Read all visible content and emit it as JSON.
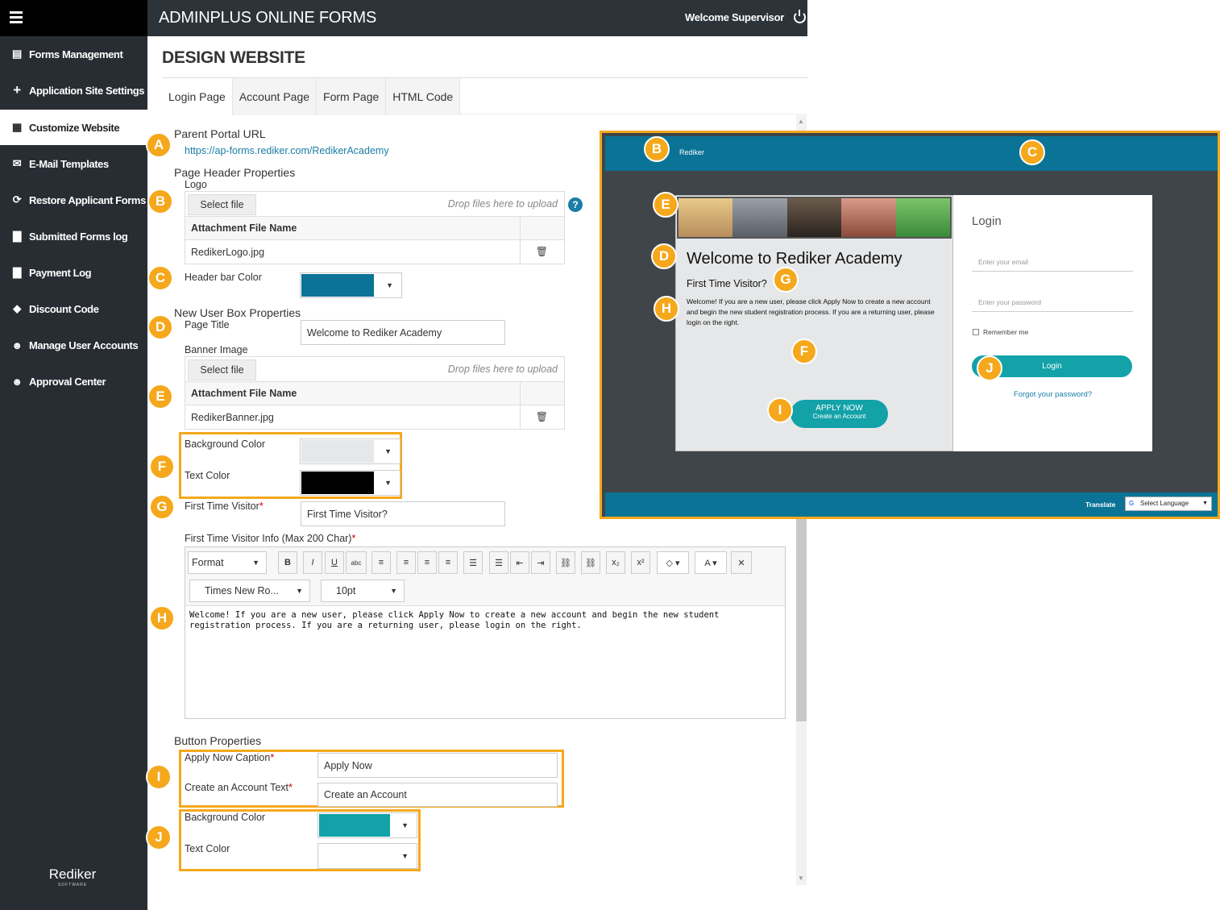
{
  "app": {
    "title": "ADMINPLUS ONLINE FORMS",
    "welcome": "Welcome Supervisor"
  },
  "sidebar": {
    "items": [
      {
        "label": "Forms Management",
        "icon": "list-icon"
      },
      {
        "label": "Application Site Settings",
        "icon": "plus-icon"
      },
      {
        "label": "Customize Website",
        "icon": "grid-icon",
        "active": true
      },
      {
        "label": "E-Mail Templates",
        "icon": "envelope-icon"
      },
      {
        "label": "Restore Applicant Forms",
        "icon": "refresh-icon"
      },
      {
        "label": "Submitted Forms log",
        "icon": "document-icon"
      },
      {
        "label": "Payment Log",
        "icon": "document-icon"
      },
      {
        "label": "Discount Code",
        "icon": "tag-icon"
      },
      {
        "label": "Manage User Accounts",
        "icon": "users-icon"
      },
      {
        "label": "Approval Center",
        "icon": "users-icon"
      }
    ],
    "logo": "Rediker",
    "logo_sub": "SOFTWARE"
  },
  "page": {
    "title": "DESIGN WEBSITE"
  },
  "tabs": [
    "Login Page",
    "Account Page",
    "Form Page",
    "HTML Code"
  ],
  "form": {
    "parent_portal_label": "Parent Portal URL",
    "parent_portal_url": "https://ap-forms.rediker.com/RedikerAcademy",
    "page_header_props": "Page Header Properties",
    "logo_label": "Logo",
    "select_file": "Select file",
    "drop_files": "Drop files here to upload",
    "attachment_header": "Attachment File Name",
    "logo_file": "RedikerLogo.jpg",
    "header_bar_color_label": "Header bar Color",
    "header_bar_color": "#0a7396",
    "new_user_box_props": "New User Box Properties",
    "page_title_label": "Page Title",
    "page_title_value": "Welcome to Rediker Academy",
    "banner_image_label": "Banner Image",
    "banner_file": "RedikerBanner.jpg",
    "bg_color_label": "Background Color",
    "bg_color": "#e6e7e8",
    "text_color_label": "Text Color",
    "text_color": "#000000",
    "first_time_label": "First Time Visitor",
    "first_time_value": "First Time Visitor?",
    "first_time_info_label": "First Time Visitor Info (Max 200 Char)",
    "editor": {
      "format": "Format",
      "font": "Times New Ro...",
      "size": "10pt",
      "content": "Welcome!  If you are a new user, please click Apply Now to create a new account and begin the new student registration process.   If you are a returning user, please login on the right."
    },
    "button_props": "Button Properties",
    "apply_caption_label": "Apply Now Caption",
    "apply_caption_value": "Apply Now",
    "create_account_label": "Create an Account Text",
    "create_account_value": "Create an Account",
    "btn_bg_color_label": "Background Color",
    "btn_bg_color": "#12a2a8",
    "btn_text_color_label": "Text Color"
  },
  "preview": {
    "logo": "Rediker",
    "welcome_title": "Welcome to Rediker Academy",
    "first_time": "First Time Visitor?",
    "info": "Welcome!  If you are a new user, please click Apply Now to create a new account and begin the new student registration process.   If you are a returning user, please login on the right.",
    "apply_now": "APPLY NOW",
    "create_account": "Create an Account",
    "login_title": "Login",
    "email_placeholder": "Enter your email",
    "password_placeholder": "Enter your password",
    "remember_me": "Remember me",
    "login_button": "Login",
    "forgot": "Forgot your password?",
    "translate": "Translate",
    "select_language": "Select Language"
  },
  "badges": {
    "a": "A",
    "b": "B",
    "c": "C",
    "d": "D",
    "e": "E",
    "f": "F",
    "g": "G",
    "h": "H",
    "i": "I",
    "j": "J"
  }
}
